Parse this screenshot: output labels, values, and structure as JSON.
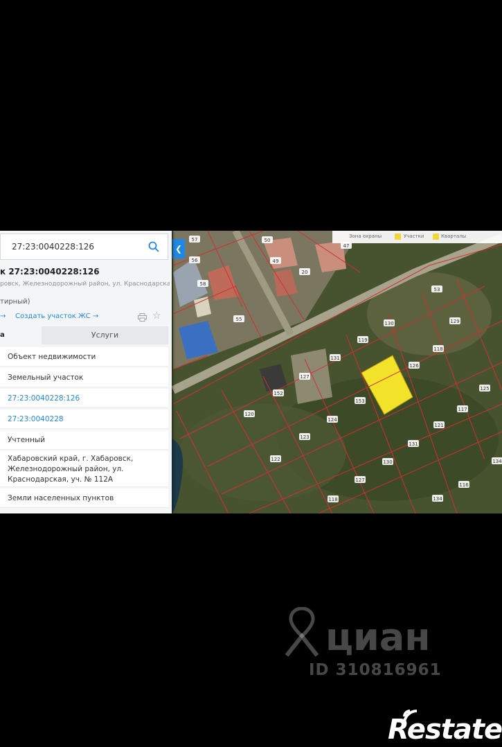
{
  "search": {
    "query": "27:23:0040228:126"
  },
  "card": {
    "title": "к 27:23:0040228:126",
    "address_line": "ровск, Железнодорожный район, ул. Краснодарская,",
    "status_fragment": "тирный)",
    "back_arrow": "→",
    "create_link": "Создать участок ЖС →"
  },
  "tabs": {
    "active": "а",
    "services": "Услуги"
  },
  "details": {
    "object_type": "Объект недвижимости",
    "kind": "Земельный участок",
    "cadastral_number": "27:23:0040228:126",
    "quarter_number": "27:23:0040228",
    "status": "Учтенный",
    "address": [
      "Хабаровский край, г. Хабаровск,",
      "Железнодорожный район, ул.",
      "Краснодарская, уч. № 112А"
    ],
    "category": "Земли населенных пунктов"
  },
  "map": {
    "legend": [
      "Зона охраны",
      "Участки",
      "Кварталы"
    ],
    "legend_colors": [
      "#e57373",
      "#f2d43b",
      "#f2d43b"
    ],
    "plot_labels": [
      "57",
      "56",
      "50",
      "49",
      "47",
      "58",
      "20",
      "55",
      "53",
      "129",
      "130",
      "119",
      "118",
      "131",
      "126",
      "127",
      "152",
      "153",
      "120",
      "117",
      "121",
      "124",
      "123",
      "131",
      "122",
      "130",
      "127",
      "118",
      "125",
      "116",
      "134",
      "134"
    ],
    "highlight_color": "#f2e22a",
    "boundary_color": "#d32f2f"
  },
  "watermark": {
    "brand": "циан",
    "id": "ID 310816961",
    "corner": "Restate"
  }
}
